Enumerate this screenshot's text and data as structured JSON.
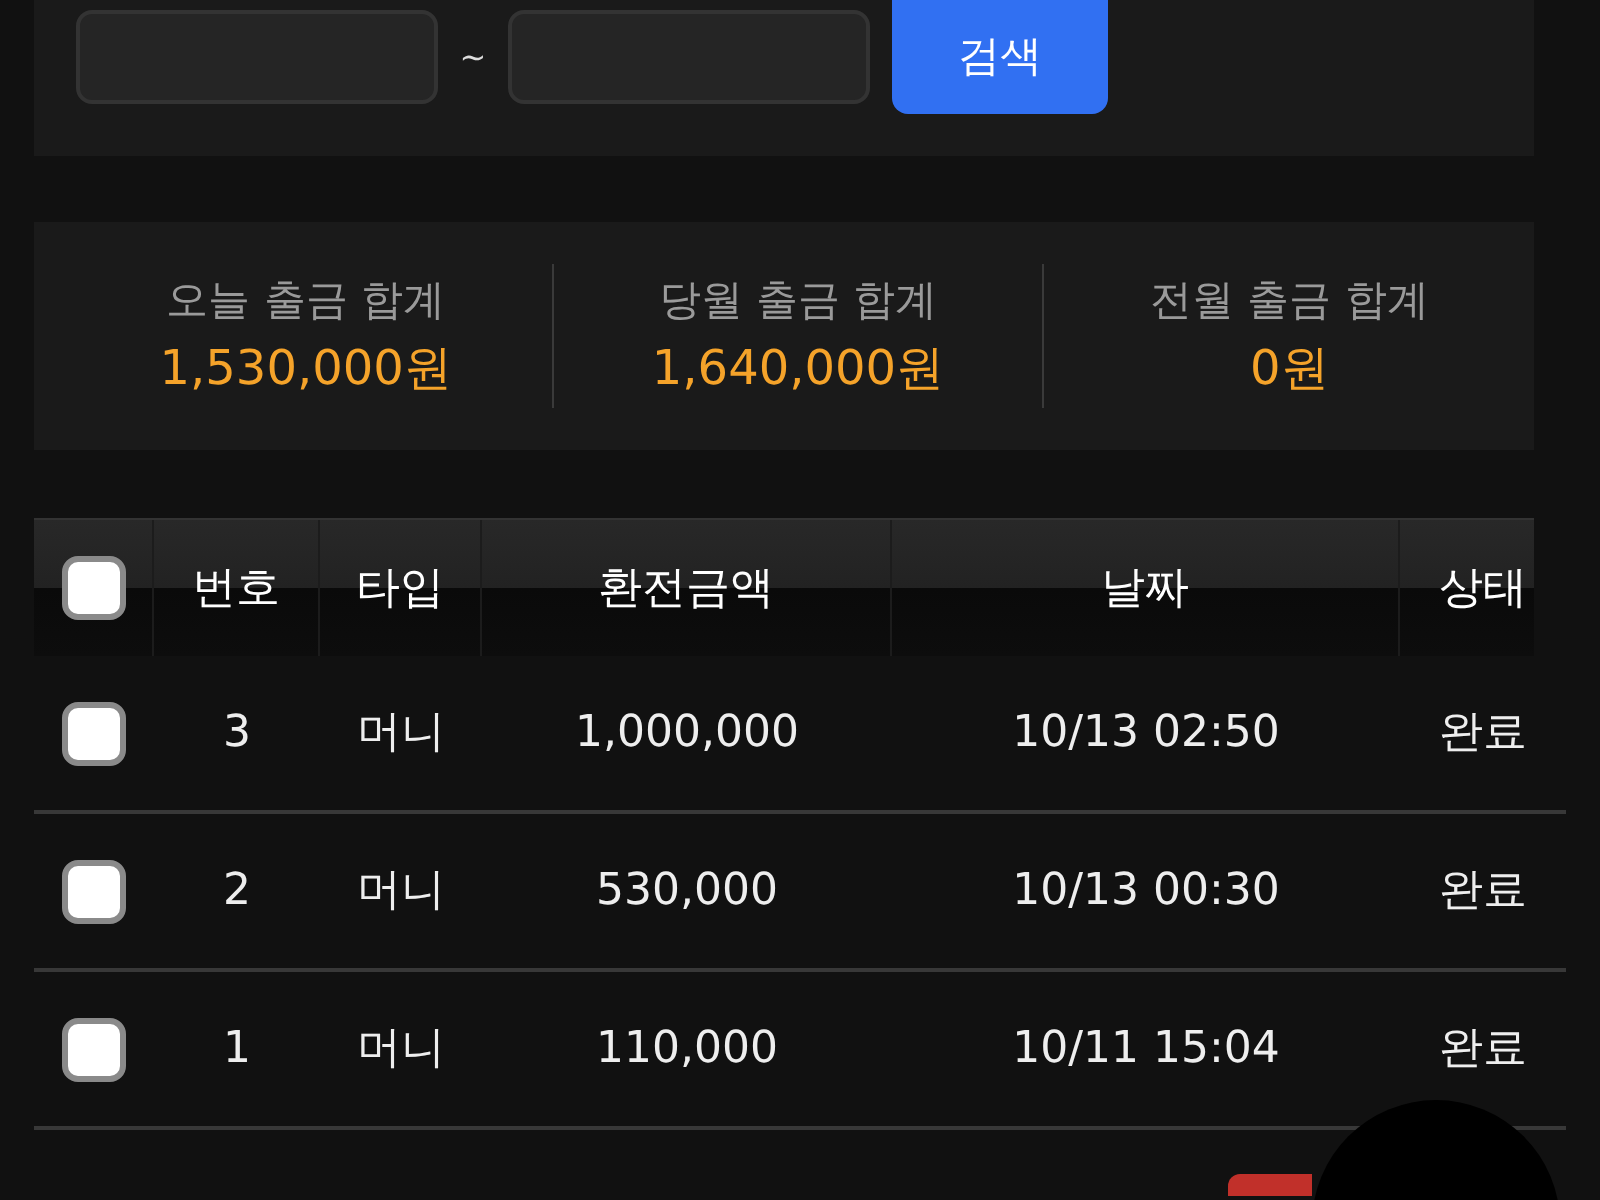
{
  "search": {
    "separator": "~",
    "button": "검색"
  },
  "summary": [
    {
      "label": "오늘 출금 합계",
      "value": "1,530,000원"
    },
    {
      "label": "당월 출금 합계",
      "value": "1,640,000원"
    },
    {
      "label": "전월 출금 합계",
      "value": "0원"
    }
  ],
  "table": {
    "select_all": {
      "checked": false
    },
    "columns": [
      "번호",
      "타입",
      "환전금액",
      "날짜",
      "상태"
    ],
    "rows": [
      {
        "checked": false,
        "cells": [
          "3",
          "머니",
          "1,000,000",
          "10/13 02:50",
          "완료"
        ]
      },
      {
        "checked": false,
        "cells": [
          "2",
          "머니",
          "530,000",
          "10/13 00:30",
          "완료"
        ]
      },
      {
        "checked": false,
        "cells": [
          "1",
          "머니",
          "110,000",
          "10/11 15:04",
          "완료"
        ]
      }
    ]
  }
}
